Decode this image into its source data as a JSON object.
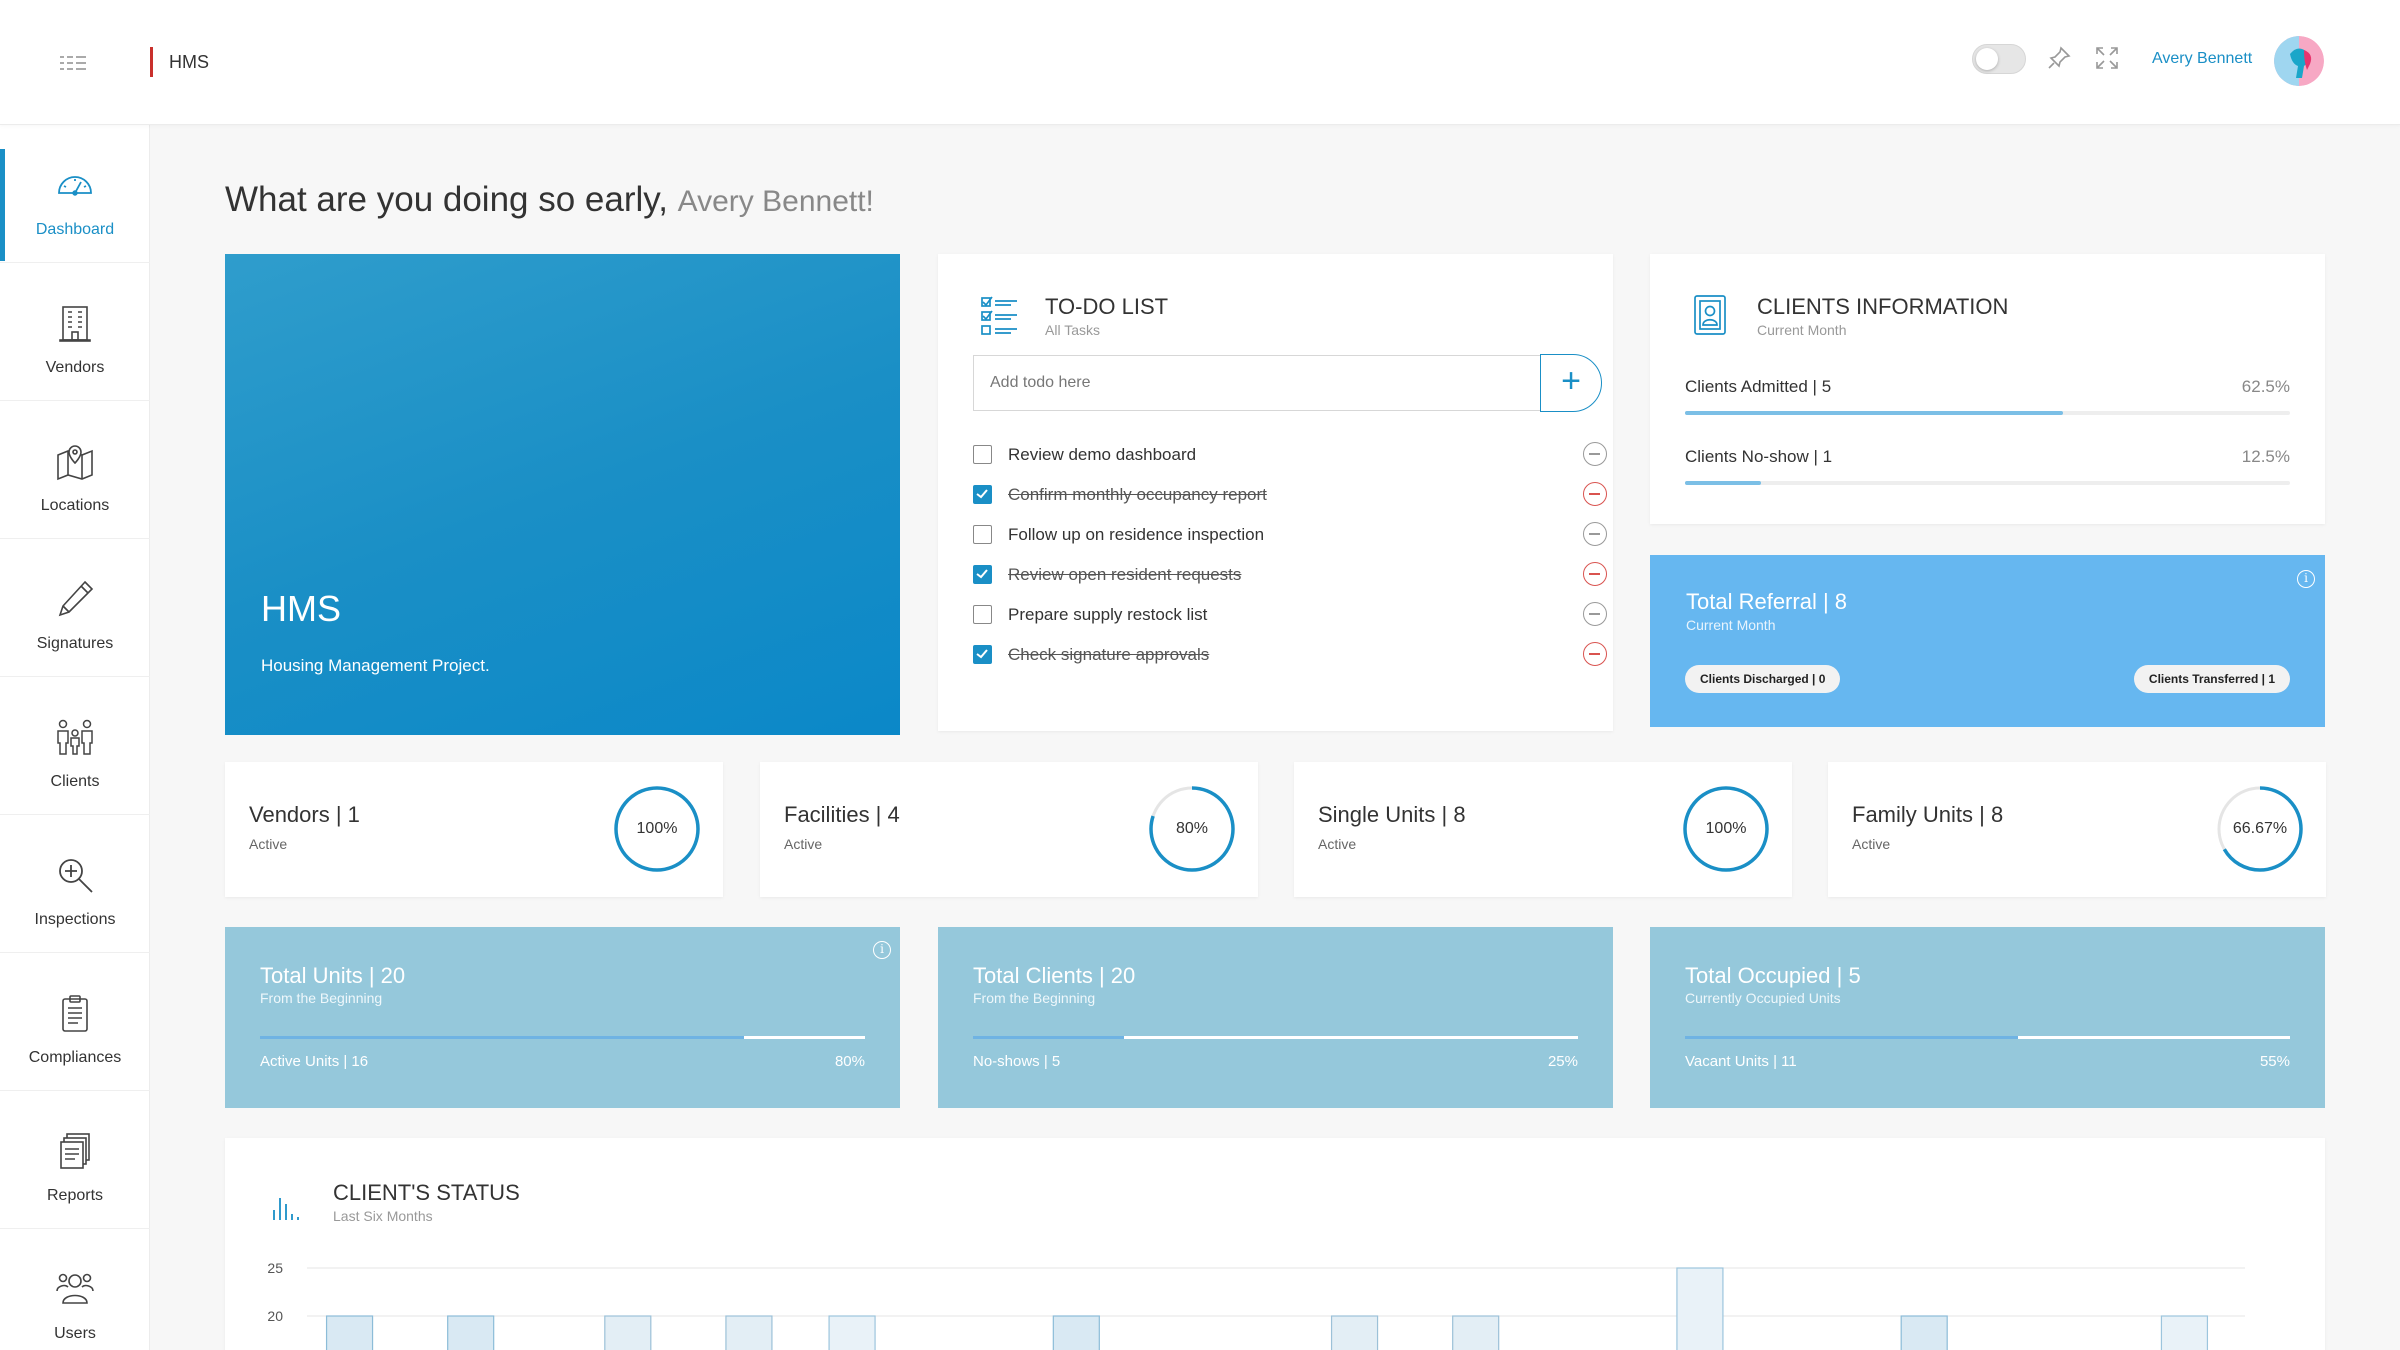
{
  "header": {
    "brand": "HMS",
    "user_name": "Avery Bennett"
  },
  "sidebar": {
    "items": [
      {
        "label": "Dashboard",
        "icon": "dashboard-icon",
        "active": true
      },
      {
        "label": "Vendors",
        "icon": "building-icon"
      },
      {
        "label": "Locations",
        "icon": "map-pin-icon"
      },
      {
        "label": "Signatures",
        "icon": "pen-icon"
      },
      {
        "label": "Clients",
        "icon": "family-icon"
      },
      {
        "label": "Inspections",
        "icon": "zoom-icon"
      },
      {
        "label": "Compliances",
        "icon": "clipboard-icon"
      },
      {
        "label": "Reports",
        "icon": "files-icon"
      },
      {
        "label": "Users",
        "icon": "users-icon"
      }
    ]
  },
  "greeting": {
    "prefix": "What are you doing so early,",
    "name": "Avery Bennett!"
  },
  "hero": {
    "title": "HMS",
    "subtitle": "Housing Management Project."
  },
  "todo": {
    "title": "TO-DO LIST",
    "subtitle": "All Tasks",
    "placeholder": "Add todo here",
    "add_label": "+",
    "items": [
      {
        "text": "Review demo dashboard",
        "done": false
      },
      {
        "text": "Confirm monthly occupancy report",
        "done": true
      },
      {
        "text": "Follow up on residence inspection",
        "done": false
      },
      {
        "text": "Review open resident requests",
        "done": true
      },
      {
        "text": "Prepare supply restock list",
        "done": false
      },
      {
        "text": "Check signature approvals",
        "done": true
      }
    ]
  },
  "clients_info": {
    "title": "CLIENTS INFORMATION",
    "subtitle": "Current Month",
    "rows": [
      {
        "label": "Clients Admitted | 5",
        "value": "62.5%",
        "fraction": 0.625
      },
      {
        "label": "Clients No-show | 1",
        "value": "12.5%",
        "fraction": 0.125
      }
    ]
  },
  "referral": {
    "title": "Total Referral | 8",
    "subtitle": "Current Month",
    "discharged": "Clients Discharged | 0",
    "transferred": "Clients Transferred | 1"
  },
  "stats": [
    {
      "title": "Vendors | 1",
      "subtitle": "Active",
      "pct": "100%",
      "fraction": 1.0
    },
    {
      "title": "Facilities | 4",
      "subtitle": "Active",
      "pct": "80%",
      "fraction": 0.8
    },
    {
      "title": "Single Units | 8",
      "subtitle": "Active",
      "pct": "100%",
      "fraction": 1.0
    },
    {
      "title": "Family Units | 8",
      "subtitle": "Active",
      "pct": "66.67%",
      "fraction": 0.6667
    }
  ],
  "totals": [
    {
      "title": "Total Units | 20",
      "subtitle": "From the Beginning",
      "bottom_label": "Active Units | 16",
      "bottom_value": "80%",
      "fraction": 0.8
    },
    {
      "title": "Total Clients | 20",
      "subtitle": "From the Beginning",
      "bottom_label": "No-shows | 5",
      "bottom_value": "25%",
      "fraction": 0.25
    },
    {
      "title": "Total Occupied | 5",
      "subtitle": "Currently Occupied Units",
      "bottom_label": "Vacant Units | 11",
      "bottom_value": "55%",
      "fraction": 0.55
    }
  ],
  "chart": {
    "title": "CLIENT'S STATUS",
    "subtitle": "Last Six Months"
  },
  "chart_data": {
    "type": "bar",
    "title": "CLIENT'S STATUS",
    "subtitle": "Last Six Months",
    "yticks": [
      25,
      20
    ],
    "ylim": [
      0,
      25
    ],
    "series": [
      {
        "values": [
          20,
          20,
          0,
          0,
          0,
          0,
          20,
          0,
          0,
          0,
          0,
          0,
          0,
          20,
          0,
          0
        ]
      },
      {
        "values": [
          0,
          0,
          0,
          0,
          20,
          0,
          0,
          0,
          0,
          0,
          0,
          25,
          0,
          0,
          0,
          20
        ]
      },
      {
        "values": [
          0,
          0,
          20,
          20,
          0,
          0,
          0,
          0,
          20,
          20,
          0,
          0,
          0,
          0,
          0,
          0
        ]
      }
    ],
    "colors": {
      "accent": "#1a8fc6"
    }
  }
}
